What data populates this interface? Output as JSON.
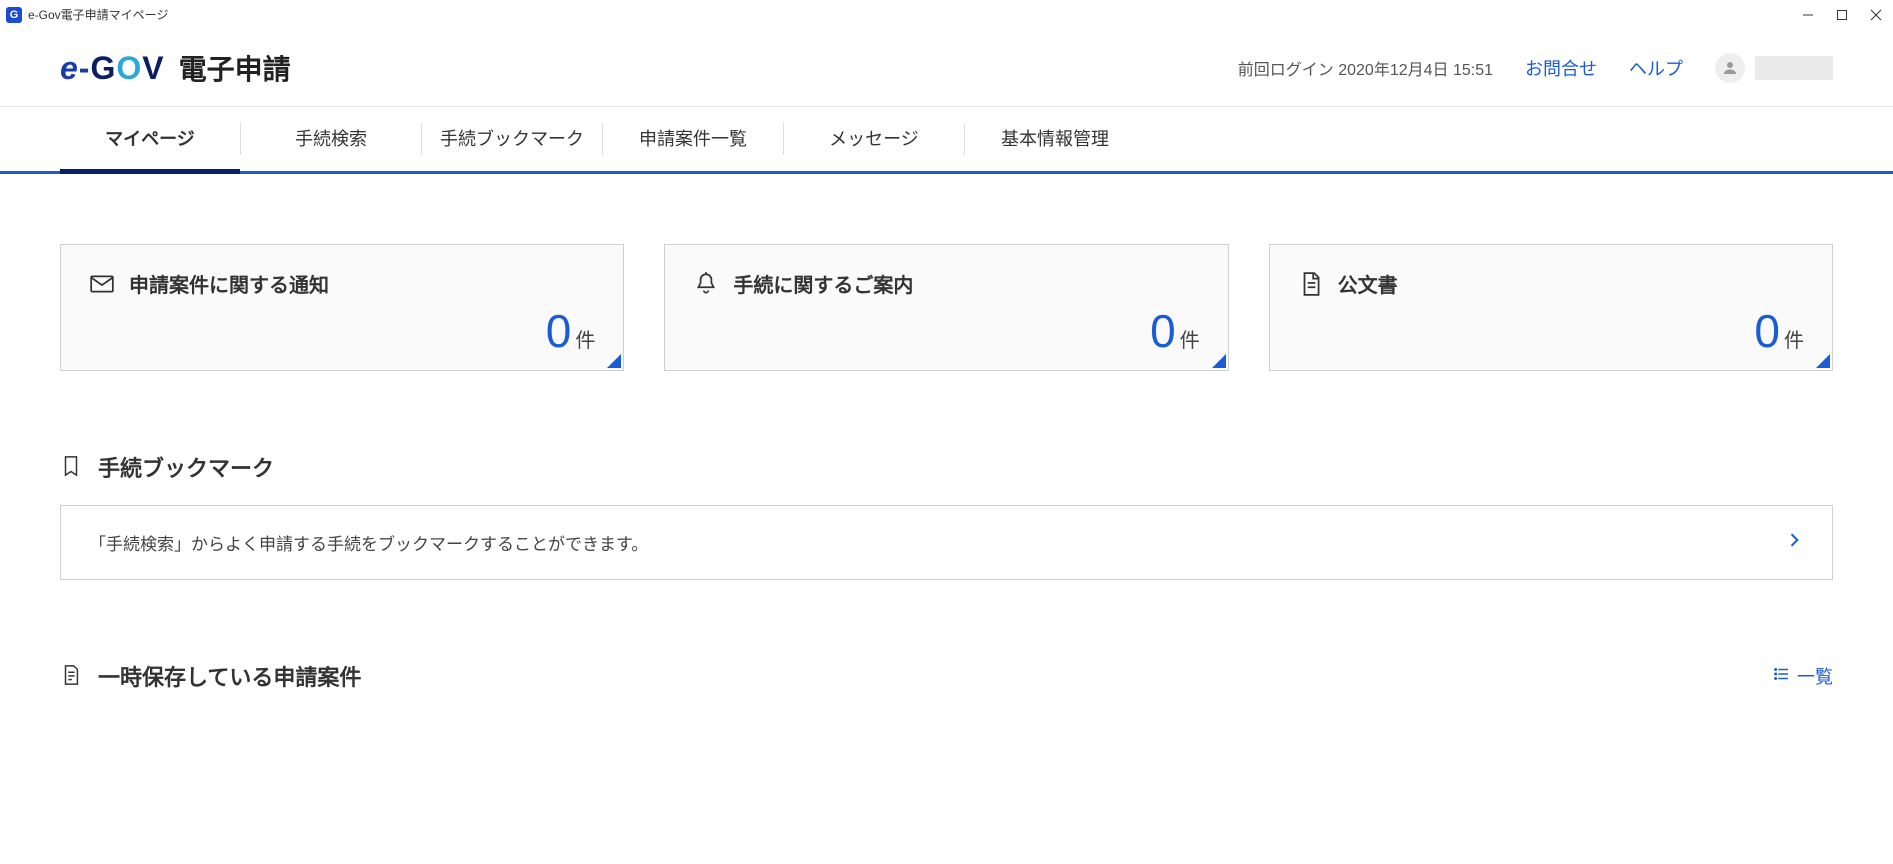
{
  "window": {
    "title": "e-Gov電子申請マイページ"
  },
  "header": {
    "logo_text": "電子申請",
    "last_login_label": "前回ログイン",
    "last_login_value": "2020年12月4日 15:51",
    "contact": "お問合せ",
    "help": "ヘルプ",
    "username": "　　　"
  },
  "nav": {
    "items": [
      {
        "label": "マイページ",
        "active": true
      },
      {
        "label": "手続検索",
        "active": false
      },
      {
        "label": "手続ブックマーク",
        "active": false
      },
      {
        "label": "申請案件一覧",
        "active": false
      },
      {
        "label": "メッセージ",
        "active": false
      },
      {
        "label": "基本情報管理",
        "active": false
      }
    ]
  },
  "cards": {
    "notice": {
      "title": "申請案件に関する通知",
      "count": "0",
      "unit": "件"
    },
    "guide": {
      "title": "手続に関するご案内",
      "count": "0",
      "unit": "件"
    },
    "docs": {
      "title": "公文書",
      "count": "0",
      "unit": "件"
    }
  },
  "bookmark_section": {
    "title": "手続ブックマーク",
    "hint": "「手続検索」からよく申請する手続をブックマークすることができます。"
  },
  "saved_section": {
    "title": "一時保存している申請案件",
    "list_link": "一覧"
  }
}
